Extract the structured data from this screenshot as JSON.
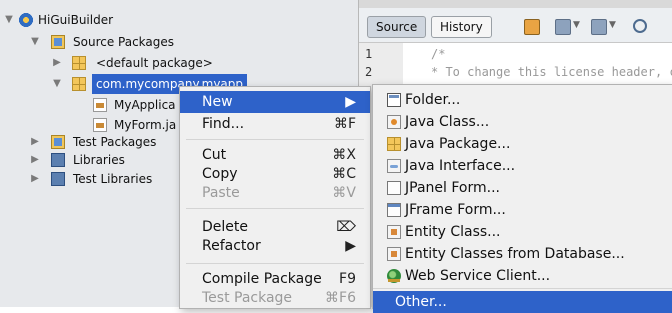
{
  "tree": {
    "project": "HiGuiBuilder",
    "source_packages": "Source Packages",
    "default_package": "<default package>",
    "selected_package": "com.mycompany.myapp",
    "files": [
      "MyApplica",
      "MyForm.ja"
    ],
    "test_packages": "Test Packages",
    "libraries": "Libraries",
    "test_libraries": "Test Libraries"
  },
  "editor": {
    "tabs": {
      "source": "Source",
      "history": "History"
    },
    "line_numbers": [
      "1",
      "2"
    ],
    "code_lines": [
      "/*",
      "* To change this license header, ch"
    ],
    "partial_char": "t"
  },
  "context_menu": {
    "items": [
      {
        "label": "New",
        "shortcut": "▶",
        "state": "highlighted"
      },
      {
        "label": "Find...",
        "shortcut": "⌘F",
        "state": "normal"
      },
      {
        "label": "Cut",
        "shortcut": "⌘X",
        "state": "normal"
      },
      {
        "label": "Copy",
        "shortcut": "⌘C",
        "state": "normal"
      },
      {
        "label": "Paste",
        "shortcut": "⌘V",
        "state": "disabled"
      },
      {
        "label": "Delete",
        "shortcut": "⌦",
        "state": "normal"
      },
      {
        "label": "Refactor",
        "shortcut": "▶",
        "state": "normal"
      },
      {
        "label": "Compile Package",
        "shortcut": "F9",
        "state": "normal"
      },
      {
        "label": "Test Package",
        "shortcut": "⌘F6",
        "state": "disabled"
      }
    ]
  },
  "new_submenu": {
    "items": [
      {
        "label": "Folder...",
        "icon": "folder-icon"
      },
      {
        "label": "Java Class...",
        "icon": "java-class-icon"
      },
      {
        "label": "Java Package...",
        "icon": "java-package-icon"
      },
      {
        "label": "Java Interface...",
        "icon": "java-interface-icon"
      },
      {
        "label": "JPanel Form...",
        "icon": "jpanel-form-icon"
      },
      {
        "label": "JFrame Form...",
        "icon": "jframe-form-icon"
      },
      {
        "label": "Entity Class...",
        "icon": "entity-class-icon"
      },
      {
        "label": "Entity Classes from Database...",
        "icon": "entity-db-icon"
      },
      {
        "label": "Web Service Client...",
        "icon": "web-service-icon"
      },
      {
        "label": "Other...",
        "icon": ""
      }
    ]
  },
  "colors": {
    "selection": "#2e62c9",
    "tree_bg": "#e7e9ec",
    "menu_bg": "#f0f0f0"
  }
}
